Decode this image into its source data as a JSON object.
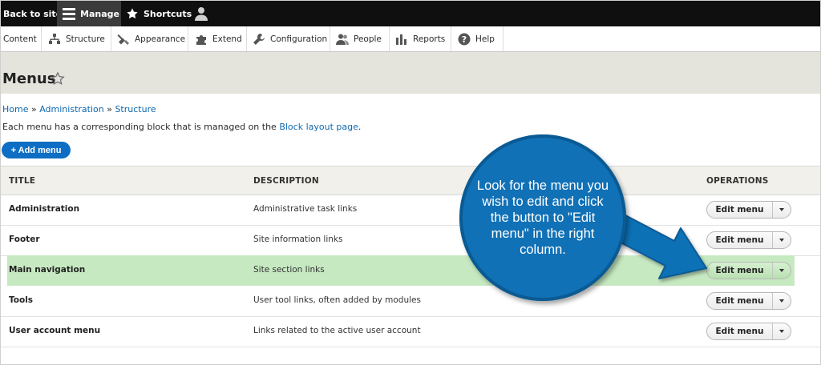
{
  "toolbar": {
    "back_to_site": "Back to site",
    "manage": "Manage",
    "shortcuts": "Shortcuts"
  },
  "tray": {
    "items": [
      "Content",
      "Structure",
      "Appearance",
      "Extend",
      "Configuration",
      "People",
      "Reports",
      "Help"
    ]
  },
  "page": {
    "title": "Menus",
    "breadcrumb": [
      "Home",
      "Administration",
      "Structure"
    ],
    "breadcrumb_sep": "»",
    "intro_prefix": "Each menu has a corresponding block that is managed on the",
    "intro_link": "Block layout page",
    "intro_suffix": ".",
    "add_button": "+ Add menu"
  },
  "table": {
    "headers": [
      "TITLE",
      "DESCRIPTION",
      "OPERATIONS"
    ],
    "rows": [
      {
        "title": "Administration",
        "description": "Administrative task links",
        "op": "Edit menu"
      },
      {
        "title": "Footer",
        "description": "Site information links",
        "op": "Edit menu"
      },
      {
        "title": "Main navigation",
        "description": "Site section links",
        "op": "Edit menu"
      },
      {
        "title": "Tools",
        "description": "User tool links, often added by modules",
        "op": "Edit menu"
      },
      {
        "title": "User account menu",
        "description": "Links related to the active user account",
        "op": "Edit menu"
      }
    ]
  },
  "callout": {
    "text": "Look for the menu you wish to edit and click the button to \"Edit menu\" in the right column."
  },
  "colors": {
    "accent": "#0d6ec4",
    "highlight_row": "#c6e9c1",
    "callout": "#1171b6"
  }
}
